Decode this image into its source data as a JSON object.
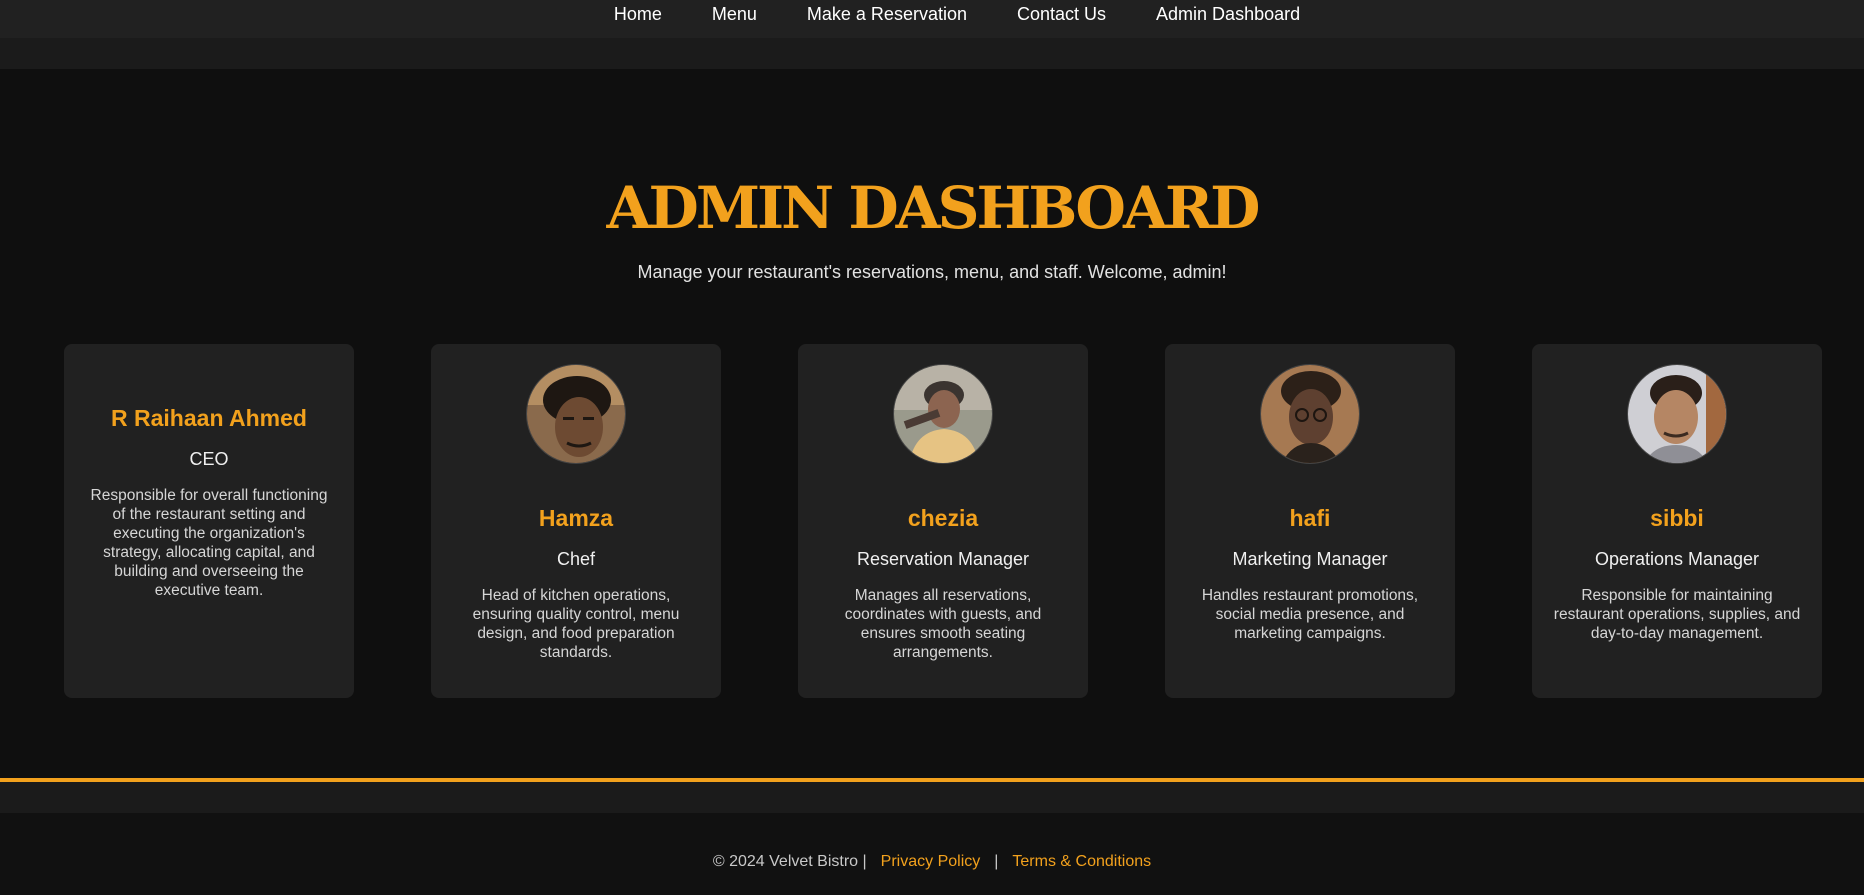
{
  "nav": {
    "items": [
      {
        "label": "Home"
      },
      {
        "label": "Menu"
      },
      {
        "label": "Make a Reservation"
      },
      {
        "label": "Contact Us"
      },
      {
        "label": "Admin Dashboard"
      }
    ]
  },
  "header": {
    "title": "ADMIN DASHBOARD",
    "subtitle": "Manage your restaurant's reservations, menu, and staff. Welcome, admin!"
  },
  "staff": [
    {
      "name": "R Raihaan Ahmed",
      "role": "CEO",
      "description": "Responsible for overall functioning of the restaurant setting and executing the organization's strategy, allocating capital, and building and overseeing the executive team."
    },
    {
      "name": "Hamza",
      "role": "Chef",
      "description": "Head of kitchen operations, ensuring quality control, menu design, and food preparation standards."
    },
    {
      "name": "chezia",
      "role": "Reservation Manager",
      "description": "Manages all reservations, coordinates with guests, and ensures smooth seating arrangements."
    },
    {
      "name": "hafi",
      "role": "Marketing Manager",
      "description": "Handles restaurant promotions, social media presence, and marketing campaigns."
    },
    {
      "name": "sibbi",
      "role": "Operations Manager",
      "description": "Responsible for maintaining restaurant operations, supplies, and day-to-day management."
    }
  ],
  "footer": {
    "copyright": "© 2024 Velvet Bistro |",
    "privacy_label": "Privacy Policy",
    "separator": "|",
    "terms_label": "Terms & Conditions"
  },
  "colors": {
    "accent": "#f2a11d",
    "background": "#111111",
    "card": "#212121"
  }
}
